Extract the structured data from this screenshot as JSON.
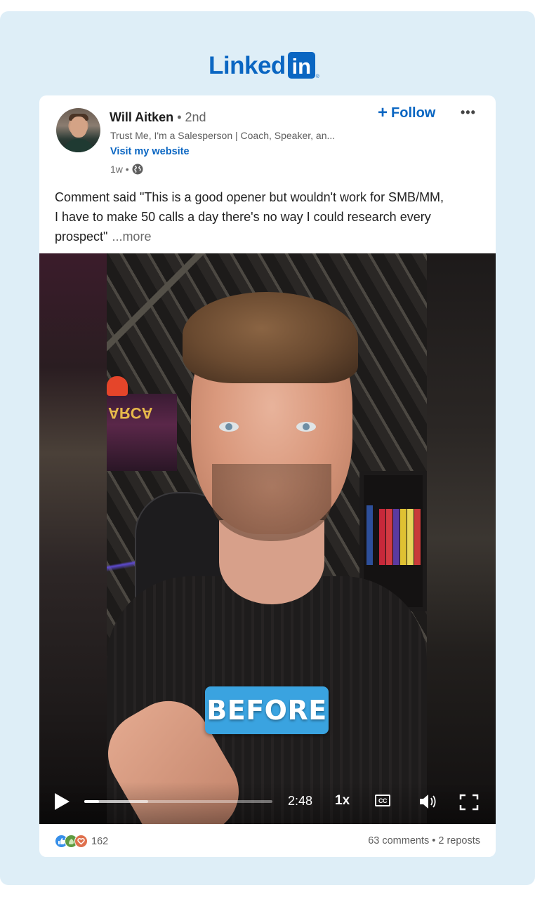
{
  "brand": {
    "logo_word": "Linked",
    "logo_box": "in",
    "logo_reg": "®",
    "color": "#0a66c2"
  },
  "post": {
    "author": {
      "name": "Will Aitken",
      "degree": " • 2nd",
      "headline": "Trust Me, I'm a Salesperson | Coach, Speaker, an...",
      "website_link": "Visit my website",
      "avatar_icon": "profile-photo"
    },
    "time": "1w •",
    "visibility_icon": "globe-icon",
    "follow_label": "Follow",
    "follow_icon": "plus-icon",
    "more_menu": "•••",
    "text": "Comment said \"This is a good opener but wouldn't work for SMB/MM, I have to make 50 calls a day there's no way I could research every prospect\"",
    "see_more": "...more"
  },
  "video": {
    "caption": "BEFORE",
    "caption_color": "#3aa3e0",
    "arcade_sign": "ARCA",
    "controls": {
      "play_icon": "play-icon",
      "progress_played": 0.08,
      "progress_buffered": 0.34,
      "time_remaining": "2:48",
      "speed": "1x",
      "cc_label": "CC",
      "volume_icon": "volume-icon",
      "fullscreen_icon": "fullscreen-icon"
    }
  },
  "social": {
    "reaction_icons": [
      "like-icon",
      "support-icon",
      "love-icon"
    ],
    "reaction_count": "162",
    "comments_reposts": "63 comments • 2 reposts"
  }
}
